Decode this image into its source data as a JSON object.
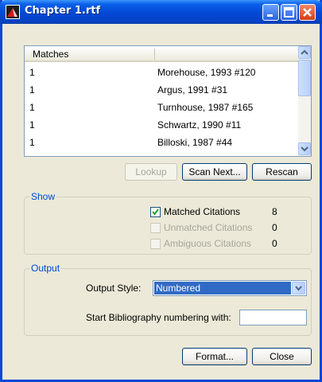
{
  "window": {
    "title": "Chapter 1.rtf"
  },
  "matches": {
    "header": "Matches",
    "rows": [
      {
        "count": "1",
        "citation": "Morehouse, 1993 #120"
      },
      {
        "count": "1",
        "citation": "Argus, 1991 #31"
      },
      {
        "count": "1",
        "citation": "Turnhouse, 1987 #165"
      },
      {
        "count": "1",
        "citation": "Schwartz, 1990 #11"
      },
      {
        "count": "1",
        "citation": "Billoski, 1987 #44"
      }
    ]
  },
  "actions": {
    "lookup": "Lookup",
    "scan_next": "Scan Next...",
    "rescan": "Rescan"
  },
  "show": {
    "label": "Show",
    "matched": {
      "label": "Matched Citations",
      "count": "8",
      "checked": true
    },
    "unmatched": {
      "label": "Unmatched Citations",
      "count": "0",
      "checked": false
    },
    "ambiguous": {
      "label": "Ambiguous Citations",
      "count": "0",
      "checked": false
    }
  },
  "output": {
    "label": "Output",
    "style_label": "Output Style:",
    "style_value": "Numbered",
    "numbering_label": "Start Bibliography numbering with:",
    "numbering_value": ""
  },
  "footer": {
    "format": "Format...",
    "close": "Close"
  },
  "colors": {
    "accent": "#0046d5",
    "selection": "#316ac5",
    "titlebar": "#0348d4"
  }
}
